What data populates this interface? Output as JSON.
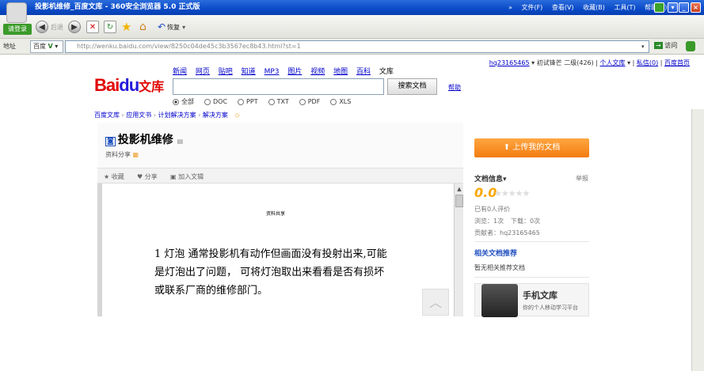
{
  "window": {
    "title": "投影机维修_百度文库 - 360安全浏览器 5.0 正式版",
    "menu": [
      "»",
      "文件(F)",
      "查看(V)",
      "收藏(B)",
      "工具(T)",
      "帮助(H)"
    ],
    "controls": [
      "▾",
      "_",
      "□",
      "×"
    ]
  },
  "toolbar": {
    "login": "请登录",
    "back": "后退",
    "restore": "恢复"
  },
  "address": {
    "label": "地址",
    "engine": "百度",
    "url": "http://wenku.baidu.com/view/8250c04de45c3b3567ec8b43.html?st=1",
    "go": "访问"
  },
  "page": {
    "userlinks": {
      "user": "hq23165465",
      "level": "初试锋芒 二级(426)",
      "my_wenku": "个人文库",
      "messages": "私信(0)",
      "home": "百度首页"
    },
    "logo": {
      "bai": "Bai",
      "du": "du",
      "wenku": "文库"
    },
    "nav": [
      "新闻",
      "网页",
      "贴吧",
      "知道",
      "MP3",
      "图片",
      "视频",
      "地图",
      "百科",
      "文库"
    ],
    "search_button": "搜索文档",
    "help": "帮助",
    "filters": [
      "全部",
      "DOC",
      "PPT",
      "TXT",
      "PDF",
      "XLS"
    ],
    "breadcrumb": [
      "百度文库",
      "应用文书",
      "计划解决方案",
      "解决方案"
    ],
    "doc": {
      "title": "投影机维修",
      "sub": "资料分享",
      "actions": [
        "收藏",
        "分享",
        "加入文辑"
      ],
      "paper_title": "资料共享",
      "lines": [
        "1 灯泡  通常投影机有动作但画面没有投射出来,可能",
        "是灯泡出了问题，   可将灯泡取出来看看是否有损坏",
        "或联系厂商的维修部门。"
      ]
    },
    "side": {
      "upload": "上传我的文档",
      "info_title": "文档信息",
      "report": "举报",
      "score": "0.0",
      "rated": "已有0人评价",
      "views": "浏览：1次",
      "downloads": "下载：0次",
      "contributor": "贡献者：hq23165465",
      "related_title": "相关文档推荐",
      "related_empty": "暂无相关推荐文档",
      "mobile_title": "手机文库",
      "mobile_sub": "你的个人移动学习平台"
    }
  }
}
